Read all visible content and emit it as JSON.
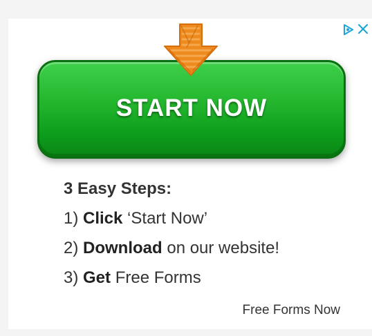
{
  "ad": {
    "start_button_label": "START NOW",
    "steps_heading": "3 Easy Steps:",
    "steps": [
      {
        "number": "1)",
        "bold": "Click",
        "rest": " ‘Start Now’"
      },
      {
        "number": "2)",
        "bold": "Download",
        "rest": " on our website!"
      },
      {
        "number": "3)",
        "bold": "Get",
        "rest": " Free Forms"
      }
    ],
    "brand": "Free Forms Now"
  },
  "colors": {
    "button_green": "#22b52c",
    "arrow_orange": "#ef8a1e",
    "adchoices_blue": "#1fa5d8"
  },
  "icons": [
    "down-arrow-icon",
    "adchoices-icon",
    "close-icon"
  ]
}
